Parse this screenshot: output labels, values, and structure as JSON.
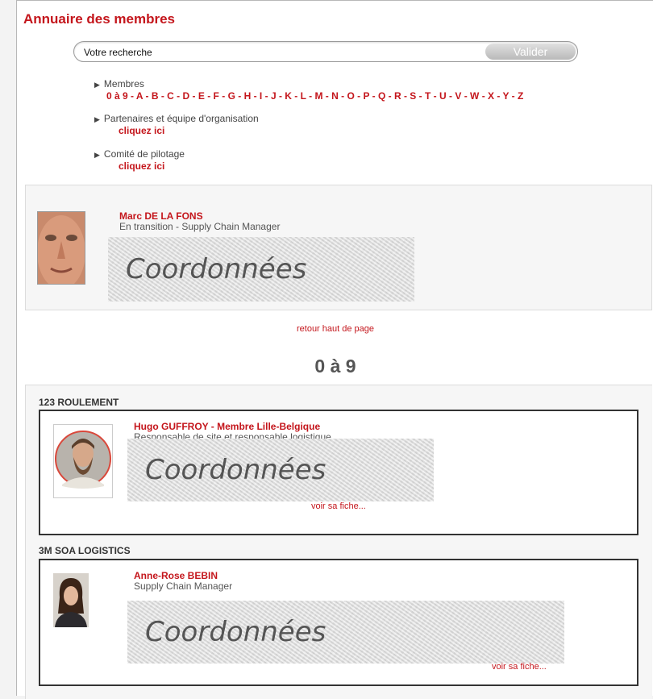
{
  "page": {
    "title": "Annuaire des membres",
    "accent_color": "#c4161c"
  },
  "search": {
    "value": "Votre recherche",
    "button_label": "Valider"
  },
  "nav": {
    "members": {
      "label": "Membres",
      "letters": [
        "0 à 9",
        "A",
        "B",
        "C",
        "D",
        "E",
        "F",
        "G",
        "H",
        "I",
        "J",
        "K",
        "L",
        "M",
        "N",
        "O",
        "P",
        "Q",
        "R",
        "S",
        "T",
        "U",
        "V",
        "W",
        "X",
        "Y",
        "Z"
      ]
    },
    "partners": {
      "label": "Partenaires et équipe d'organisation",
      "link": "cliquez ici"
    },
    "committee": {
      "label": "Comité de pilotage",
      "link": "cliquez ici"
    }
  },
  "featured": {
    "name": "Marc DE LA FONS",
    "role": "En transition - Supply Chain Manager",
    "coord_label": "Coordonnées"
  },
  "retour_label": "retour haut de page",
  "section": {
    "heading": "0 à 9",
    "entries": [
      {
        "company": "123 ROULEMENT",
        "name": "Hugo GUFFROY - Membre Lille-Belgique",
        "role": "Responsable de site et responsable logistique",
        "coord_label": "Coordonnées",
        "voir": "voir sa fiche..."
      },
      {
        "company": "3M SOA LOGISTICS",
        "name": "Anne-Rose BEBIN",
        "role": "Supply Chain Manager",
        "coord_label": "Coordonnées",
        "voir": "voir sa fiche..."
      }
    ]
  }
}
